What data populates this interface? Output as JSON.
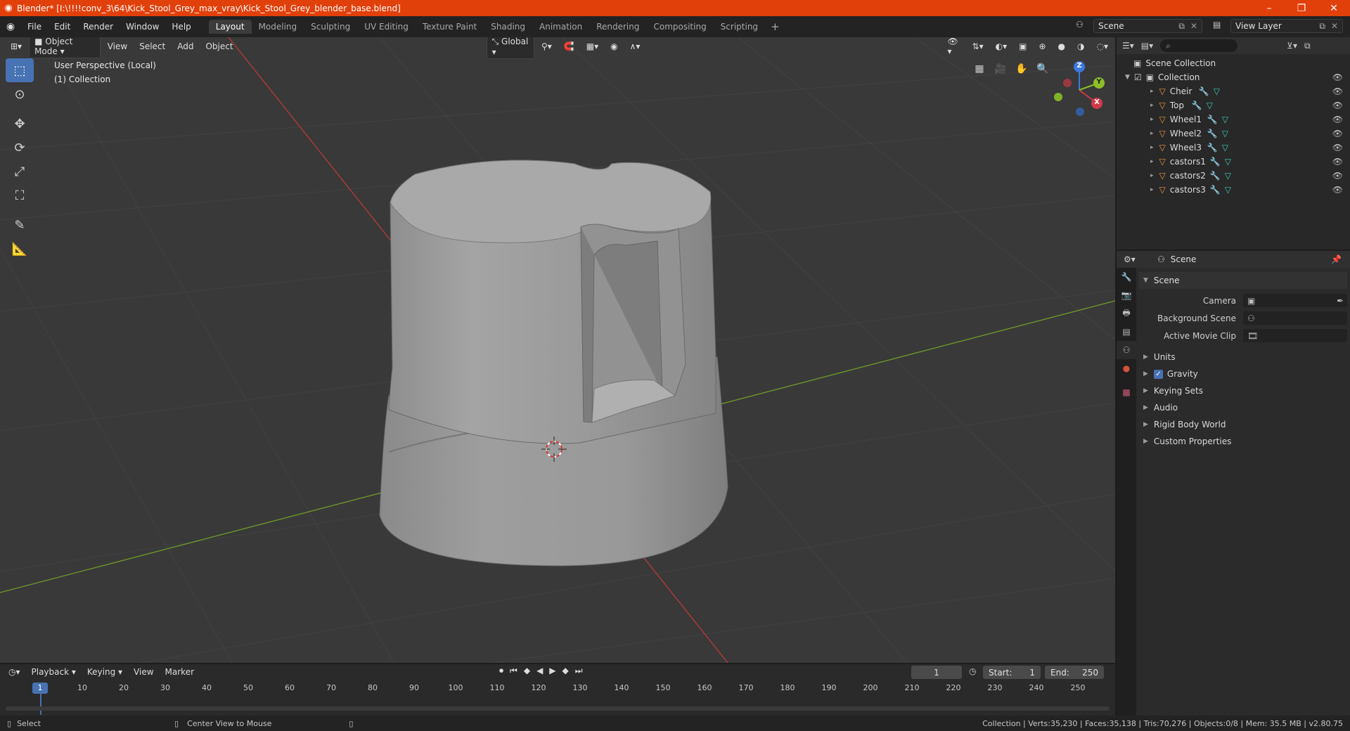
{
  "window": {
    "title": "Blender* [I:\\!!!!conv_3\\64\\Kick_Stool_Grey_max_vray\\Kick_Stool_Grey_blender_base.blend]",
    "minimize": "–",
    "restore": "❐",
    "close": "✕"
  },
  "menu": [
    "File",
    "Edit",
    "Render",
    "Window",
    "Help"
  ],
  "workspaces": [
    "Layout",
    "Modeling",
    "Sculpting",
    "UV Editing",
    "Texture Paint",
    "Shading",
    "Animation",
    "Rendering",
    "Compositing",
    "Scripting"
  ],
  "active_workspace": "Layout",
  "scene_name": "Scene",
  "view_layer": "View Layer",
  "viewport": {
    "mode": "Object Mode",
    "menus": [
      "View",
      "Select",
      "Add",
      "Object"
    ],
    "orientation": "Global",
    "perspective": "User Perspective (Local)",
    "collection": "(1) Collection",
    "axis_x": "X",
    "axis_y": "Y",
    "axis_z": "Z"
  },
  "outliner": {
    "root": "Scene Collection",
    "collection": "Collection",
    "objects": [
      "Cheir",
      "Top",
      "Wheel1",
      "Wheel2",
      "Wheel3",
      "castors1",
      "castors2",
      "castors3"
    ]
  },
  "properties": {
    "header": "Scene",
    "section": "Scene",
    "fields": [
      {
        "label": "Camera",
        "value": ""
      },
      {
        "label": "Background Scene",
        "value": ""
      },
      {
        "label": "Active Movie Clip",
        "value": ""
      }
    ],
    "panels": [
      "Units",
      "Gravity",
      "Keying Sets",
      "Audio",
      "Rigid Body World",
      "Custom Properties"
    ],
    "gravity_checked": true
  },
  "timeline": {
    "menus": [
      "Playback",
      "Keying",
      "View",
      "Marker"
    ],
    "current_frame": "1",
    "start_label": "Start:",
    "start": "1",
    "end_label": "End:",
    "end": "250",
    "ticks": [
      "10",
      "20",
      "30",
      "40",
      "50",
      "60",
      "70",
      "80",
      "90",
      "100",
      "110",
      "120",
      "130",
      "140",
      "150",
      "160",
      "170",
      "180",
      "190",
      "200",
      "210",
      "220",
      "230",
      "240",
      "250"
    ]
  },
  "status": {
    "left_action": "Select",
    "middle_action": "Center View to Mouse",
    "stats": "Collection | Verts:35,230 | Faces:35,138 | Tris:70,276 | Objects:0/8 | Mem: 35.5 MB | v2.80.75"
  }
}
